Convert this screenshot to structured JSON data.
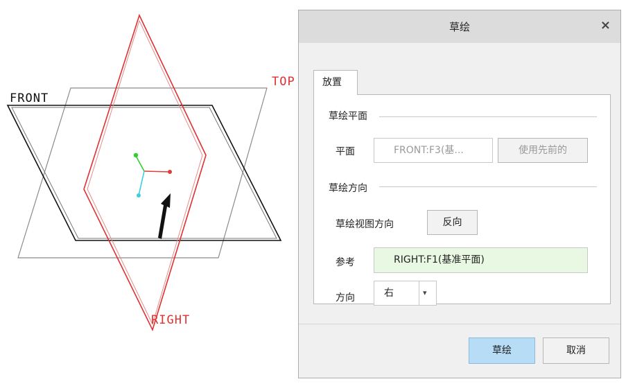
{
  "viewport": {
    "labels": {
      "front": "FRONT",
      "top": "TOP",
      "right": "RIGHT"
    },
    "colors": {
      "front_plane": "#111111",
      "top_plane": "#888888",
      "right_plane": "#e03030",
      "axis_x": "#e03c3c",
      "axis_y": "#2fcf2f",
      "axis_z": "#3ad0e0",
      "arrow": "#111111"
    },
    "icons": [
      "coordinate-axes",
      "sketch-direction-arrow"
    ]
  },
  "dialog": {
    "title": "草绘",
    "close_icon": "×",
    "tab_label": "放置",
    "sketch_plane_section": "草绘平面",
    "plane_label": "平面",
    "plane_value": "FRONT:F3(基...",
    "use_previous_label": "使用先前的",
    "sketch_orientation_section": "草绘方向",
    "view_direction_label": "草绘视图方向",
    "flip_label": "反向",
    "reference_label": "参考",
    "reference_value": "RIGHT:F1(基准平面)",
    "direction_label": "方向",
    "direction_value": "右",
    "dropdown_icon": "▾",
    "sketch_button": "草绘",
    "cancel_button": "取消",
    "colors": {
      "reference_bg": "#e8f8e2",
      "sketch_button_bg": "#b7dcf5",
      "disabled_text": "#9a9a9a"
    }
  }
}
